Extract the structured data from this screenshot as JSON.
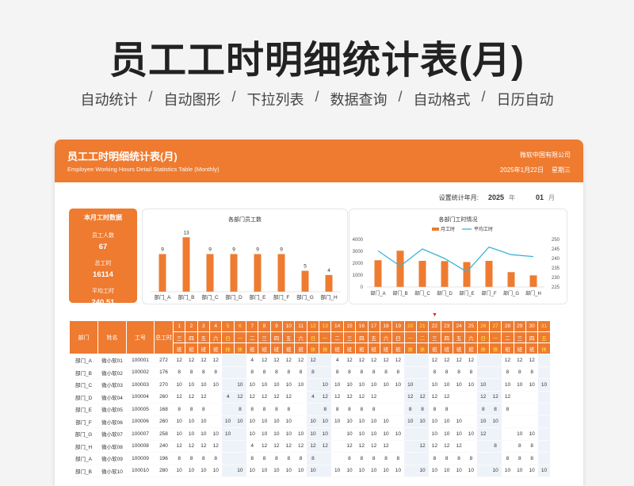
{
  "hero": {
    "title": "员工工时明细统计表(月)",
    "features": [
      "自动统计",
      "自动图形",
      "下拉列表",
      "数据查询",
      "自动格式",
      "日历自动"
    ],
    "separator": "/"
  },
  "header": {
    "title": "员工工时明细统计表(月)",
    "subtitle": "Employee Working Hours Detail Statistics Table (Monthly)",
    "company": "微软中国有限公司",
    "date": "2025年1月22日",
    "weekday": "星期三"
  },
  "setting": {
    "label": "设置统计年月:",
    "year": "2025",
    "year_unit": "年",
    "month": "01",
    "month_unit": "月"
  },
  "stats": {
    "title": "本月工时数据",
    "items": [
      {
        "label": "员工人数",
        "value": "67"
      },
      {
        "label": "总工时",
        "value": "16114"
      },
      {
        "label": "平均工时",
        "value": "240.51"
      }
    ]
  },
  "colors": {
    "accent": "#ee7b30",
    "line": "#3bb3d6",
    "weekend": "#ffe94a",
    "marker": "#d9261c"
  },
  "chart_data": [
    {
      "type": "bar",
      "title": "各部门员工数",
      "categories": [
        "部门_A",
        "部门_B",
        "部门_C",
        "部门_D",
        "部门_E",
        "部门_F",
        "部门_G",
        "部门_H"
      ],
      "values": [
        9,
        13,
        9,
        9,
        9,
        9,
        5,
        4
      ],
      "ylim": [
        0,
        14
      ],
      "grid": false,
      "data_labels": true
    },
    {
      "type": "bar",
      "title": "各部门工时情况",
      "categories": [
        "部门_A",
        "部门_B",
        "部门_C",
        "部门_D",
        "部门_E",
        "部门_F",
        "部门_G",
        "部门_H"
      ],
      "series": [
        {
          "name": "月工时",
          "type": "bar",
          "axis": "left",
          "values": [
            2250,
            3050,
            2200,
            2180,
            2100,
            2200,
            1250,
            980
          ]
        },
        {
          "name": "平均工时",
          "type": "line",
          "axis": "right",
          "values": [
            244,
            236,
            245,
            240,
            233,
            246,
            242,
            241
          ]
        }
      ],
      "y_left": {
        "ticks": [
          0,
          1000,
          2000,
          3000,
          4000
        ],
        "ylim": [
          0,
          4000
        ]
      },
      "y_right": {
        "ticks": [
          225,
          230,
          235,
          240,
          245,
          250
        ],
        "ylim": [
          225,
          250
        ]
      },
      "legend": "top"
    }
  ],
  "table": {
    "headers": {
      "dept": "部门",
      "name": "姓名",
      "id": "工号",
      "total": "总工时"
    },
    "days": [
      "1",
      "2",
      "3",
      "4",
      "5",
      "6",
      "7",
      "8",
      "9",
      "10",
      "11",
      "12",
      "13",
      "14",
      "15",
      "16",
      "17",
      "18",
      "19",
      "20",
      "21",
      "22",
      "23",
      "24",
      "25",
      "26",
      "27",
      "28",
      "29",
      "30",
      "31"
    ],
    "weekdays": [
      "三",
      "四",
      "五",
      "六",
      "日",
      "一",
      "二",
      "三",
      "四",
      "五",
      "六",
      "日",
      "一",
      "二",
      "三",
      "四",
      "五",
      "六",
      "日",
      "一",
      "二",
      "三",
      "四",
      "五",
      "六",
      "日",
      "一",
      "二",
      "三",
      "四",
      "五"
    ],
    "shifts": [
      "班",
      "班",
      "班",
      "班",
      "休",
      "休",
      "班",
      "班",
      "班",
      "班",
      "班",
      "休",
      "休",
      "班",
      "班",
      "班",
      "班",
      "班",
      "班",
      "休",
      "休",
      "班",
      "班",
      "班",
      "班",
      "休",
      "休",
      "班",
      "班",
      "班",
      "休"
    ],
    "weekend_days": [
      5,
      6,
      12,
      13,
      20,
      21,
      26,
      27,
      31
    ],
    "today_day": 22,
    "marker": "▼",
    "rows": [
      {
        "dept": "部门_A",
        "name": "微小软01",
        "id": "100001",
        "total": "272",
        "h": [
          "12",
          "12",
          "12",
          "12",
          "",
          "",
          "4",
          "12",
          "12",
          "12",
          "12",
          "12",
          "",
          "4",
          "12",
          "12",
          "12",
          "12",
          "12",
          "",
          "",
          "12",
          "12",
          "12",
          "12",
          "",
          "",
          "12",
          "12",
          "12",
          ""
        ]
      },
      {
        "dept": "部门_B",
        "name": "微小软02",
        "id": "100002",
        "total": "176",
        "h": [
          "8",
          "8",
          "8",
          "8",
          "",
          "",
          "8",
          "8",
          "8",
          "8",
          "8",
          "8",
          "",
          "8",
          "8",
          "8",
          "8",
          "8",
          "8",
          "",
          "",
          "8",
          "8",
          "8",
          "8",
          "",
          "",
          "8",
          "8",
          "8",
          ""
        ]
      },
      {
        "dept": "部门_C",
        "name": "微小软03",
        "id": "100003",
        "total": "270",
        "h": [
          "10",
          "10",
          "10",
          "10",
          "",
          "10",
          "10",
          "10",
          "10",
          "10",
          "10",
          "",
          "10",
          "10",
          "10",
          "10",
          "10",
          "10",
          "10",
          "10",
          "",
          "10",
          "10",
          "10",
          "10",
          "10",
          "",
          "10",
          "10",
          "10",
          "10"
        ]
      },
      {
        "dept": "部门_D",
        "name": "微小软04",
        "id": "100004",
        "total": "260",
        "h": [
          "12",
          "12",
          "12",
          "",
          "4",
          "12",
          "12",
          "12",
          "12",
          "12",
          "",
          "4",
          "12",
          "12",
          "12",
          "12",
          "12",
          "",
          "",
          "12",
          "12",
          "12",
          "12",
          "",
          "",
          "12",
          "12",
          "12",
          "",
          "",
          ""
        ]
      },
      {
        "dept": "部门_E",
        "name": "微小软05",
        "id": "100005",
        "total": "168",
        "h": [
          "8",
          "8",
          "8",
          "",
          "",
          "8",
          "8",
          "8",
          "8",
          "8",
          "",
          "",
          "8",
          "8",
          "8",
          "8",
          "8",
          "",
          "",
          "8",
          "8",
          "8",
          "8",
          "",
          "",
          "8",
          "8",
          "8",
          "",
          "",
          ""
        ]
      },
      {
        "dept": "部门_F",
        "name": "微小软06",
        "id": "100006",
        "total": "260",
        "h": [
          "10",
          "10",
          "10",
          "",
          "10",
          "10",
          "10",
          "10",
          "10",
          "10",
          "",
          "10",
          "10",
          "10",
          "10",
          "10",
          "10",
          "10",
          "",
          "10",
          "10",
          "10",
          "10",
          "10",
          "",
          "10",
          "10",
          "",
          "",
          "",
          ""
        ]
      },
      {
        "dept": "部门_G",
        "name": "微小软07",
        "id": "100007",
        "total": "258",
        "h": [
          "10",
          "10",
          "10",
          "10",
          "10",
          "",
          "10",
          "10",
          "10",
          "10",
          "10",
          "10",
          "10",
          "",
          "10",
          "10",
          "10",
          "10",
          "10",
          "",
          "",
          "10",
          "10",
          "10",
          "10",
          "12",
          "",
          "",
          "10",
          "10",
          ""
        ]
      },
      {
        "dept": "部门_H",
        "name": "微小软08",
        "id": "100008",
        "total": "240",
        "h": [
          "12",
          "12",
          "12",
          "12",
          "",
          "",
          "4",
          "12",
          "12",
          "12",
          "12",
          "12",
          "12",
          "",
          "12",
          "12",
          "12",
          "12",
          "",
          "",
          "12",
          "12",
          "12",
          "12",
          "",
          "",
          "8",
          "",
          "8",
          "8",
          ""
        ]
      },
      {
        "dept": "部门_A",
        "name": "微小软09",
        "id": "100009",
        "total": "196",
        "h": [
          "8",
          "8",
          "8",
          "8",
          "",
          "",
          "8",
          "8",
          "8",
          "8",
          "8",
          "8",
          "",
          "",
          "8",
          "8",
          "8",
          "8",
          "8",
          "",
          "",
          "8",
          "8",
          "8",
          "8",
          "",
          "",
          "8",
          "8",
          "8",
          ""
        ]
      },
      {
        "dept": "部门_B",
        "name": "微小软10",
        "id": "100010",
        "total": "280",
        "h": [
          "10",
          "10",
          "10",
          "10",
          "",
          "10",
          "10",
          "10",
          "10",
          "10",
          "10",
          "10",
          "",
          "10",
          "10",
          "10",
          "10",
          "10",
          "10",
          "",
          "10",
          "10",
          "10",
          "10",
          "10",
          "",
          "10",
          "10",
          "10",
          "10",
          "10"
        ]
      }
    ]
  }
}
